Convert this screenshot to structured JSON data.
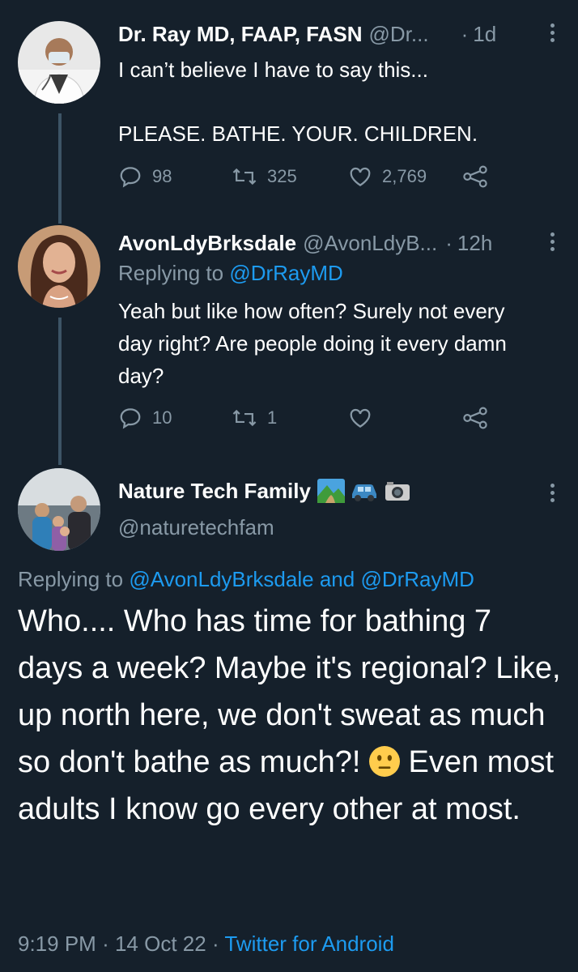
{
  "tweet1": {
    "name": "Dr. Ray MD, FAAP, FASN",
    "handle": "@Dr...",
    "separator": "·",
    "time": "1d",
    "text_line1": "I can’t believe I have to say this...",
    "text_line2": "PLEASE. BATHE. YOUR. CHILDREN.",
    "replies": "98",
    "retweets": "325",
    "likes": "2,769"
  },
  "tweet2": {
    "name": "AvonLdyBrksdale",
    "handle": "@AvonLdyB...",
    "separator": "·",
    "time": "12h",
    "replying_prefix": "Replying to",
    "replying_to": "@DrRayMD",
    "text": "Yeah but like how often? Surely not every day right? Are people doing it every damn day?",
    "replies": "10",
    "retweets": "1",
    "likes": ""
  },
  "tweet3": {
    "name": "Nature Tech Family",
    "name_emoji_names": [
      "national-park-emoji",
      "car-emoji",
      "camera-emoji"
    ],
    "handle": "@naturetechfam",
    "replying_prefix": "Replying to",
    "replying_to_1": "@AvonLdyBrksdale",
    "replying_and": "and",
    "replying_to_2": "@DrRayMD",
    "text_part1": "Who.... Who has time for bathing 7 days a week? Maybe it's regional? Like, up north here, we don't sweat as much so don't bathe as much?!",
    "text_emoji": "neutral-face-emoji",
    "text_part2": "Even most adults I know go every other at most.",
    "meta_time": "9:19 PM",
    "meta_sep1": "·",
    "meta_date": "14 Oct 22",
    "meta_sep2": "·",
    "meta_source": "Twitter for Android"
  },
  "colors": {
    "background": "#15202b",
    "secondary_text": "#8899a6",
    "link": "#1d9bf0",
    "thread_line": "#3d5466"
  }
}
